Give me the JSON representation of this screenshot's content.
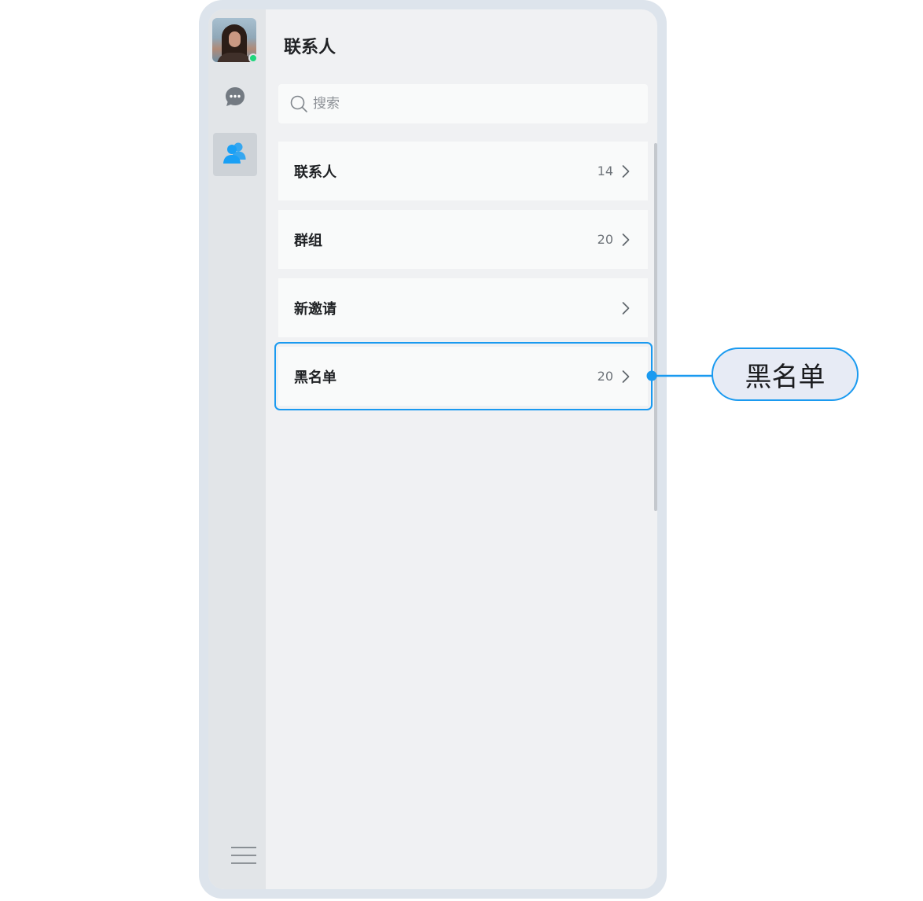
{
  "header": {
    "title": "联系人"
  },
  "search": {
    "placeholder": "搜索",
    "value": ""
  },
  "nav": {
    "avatar_status": "online",
    "items": [
      {
        "icon": "chat-bubble-icon",
        "active": false
      },
      {
        "icon": "contacts-icon",
        "active": true
      }
    ],
    "menu_icon": "hamburger-menu-icon"
  },
  "contacts_menu": {
    "items": [
      {
        "label": "联系人",
        "count": "14"
      },
      {
        "label": "群组",
        "count": "20"
      },
      {
        "label": "新邀请",
        "count": ""
      },
      {
        "label": "黑名单",
        "count": "20"
      }
    ]
  },
  "callout": {
    "label": "黑名单"
  },
  "colors": {
    "accent": "#1a9af0",
    "online": "#1ed67c",
    "contacts_icon": "#1aa0f5",
    "callout_bg": "#e7ebf5"
  }
}
